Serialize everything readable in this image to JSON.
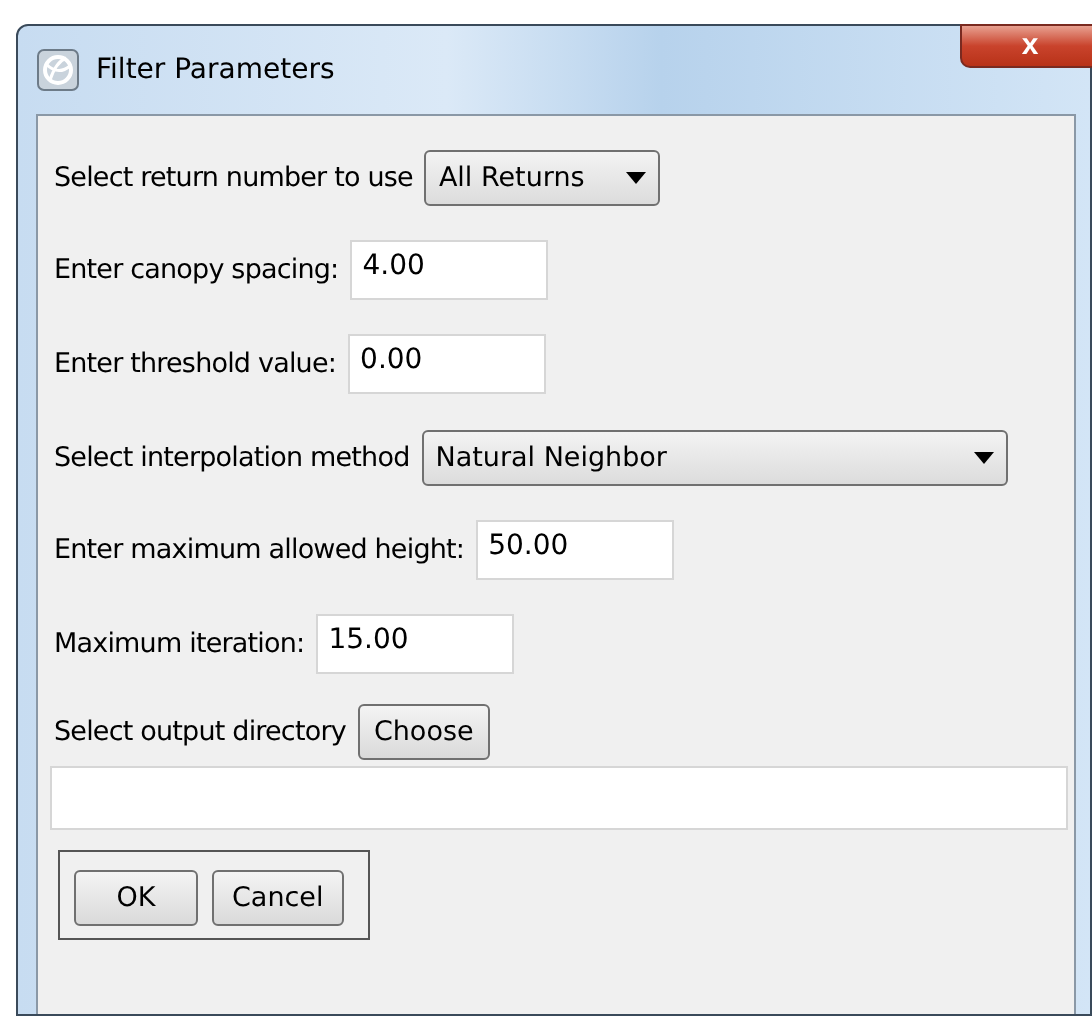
{
  "window": {
    "title": "Filter Parameters",
    "close": "x"
  },
  "rows": [
    {
      "kind": "combo",
      "label": "Select return number to use",
      "value": "All Returns"
    },
    {
      "kind": "text",
      "label": "Enter canopy spacing:",
      "value": "4.00"
    },
    {
      "kind": "text",
      "label": "Enter threshold value:",
      "value": "0.00"
    },
    {
      "kind": "combo",
      "label": "Select interpolation method",
      "value": "Natural Neighbor",
      "wide": true
    },
    {
      "kind": "text",
      "label": "Enter maximum allowed height:",
      "value": "50.00"
    },
    {
      "kind": "text",
      "label": "Maximum iteration:",
      "value": "15.00"
    },
    {
      "kind": "button",
      "label": "Select output directory",
      "value": "Choose"
    }
  ],
  "buttons": [
    "OK",
    "Cancel"
  ]
}
